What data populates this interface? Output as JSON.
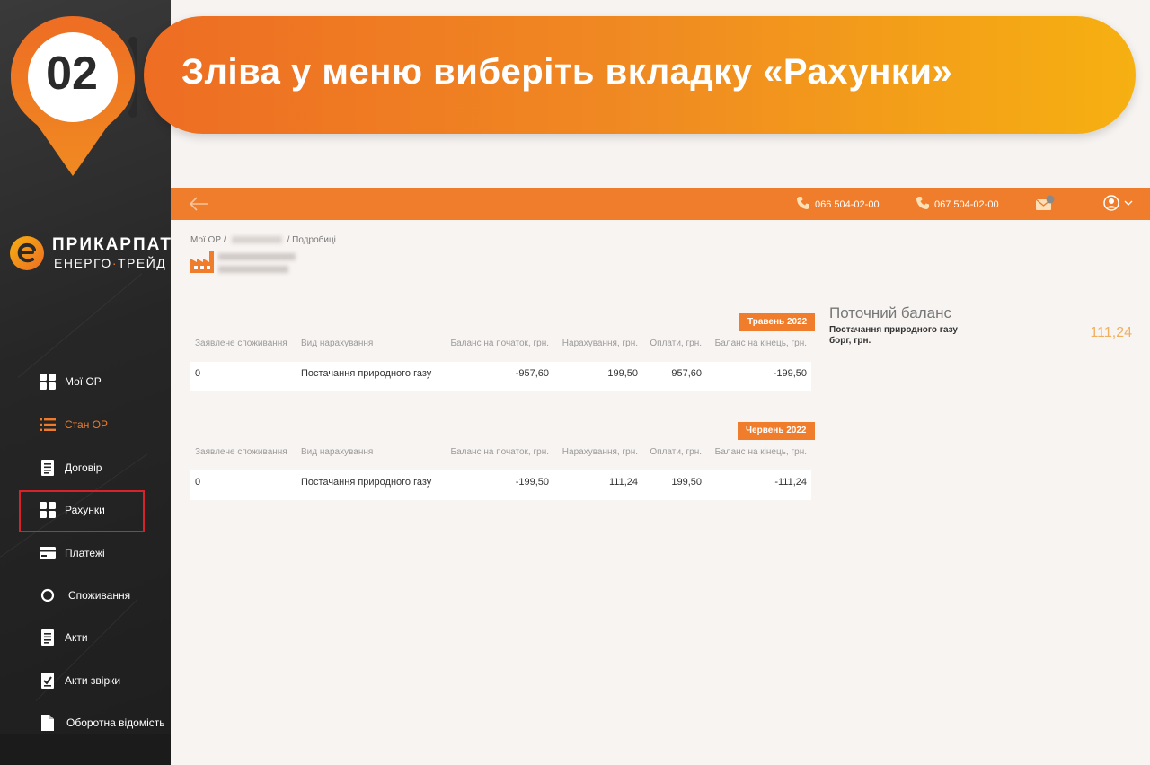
{
  "banner": {
    "step_number": "02",
    "text": "Зліва у меню виберіть вкладку «Рахунки»"
  },
  "logo": {
    "name": "ПРИКАРПАТ",
    "sub_left": "ЕНЕРГО",
    "sub_dot": "·",
    "sub_right": "ТРЕЙД"
  },
  "sidebar": {
    "items": [
      {
        "label": "Мої ОР",
        "icon": "grid-icon",
        "active": false
      },
      {
        "label": "Стан ОР",
        "icon": "list-icon",
        "active": true
      },
      {
        "label": "Договір",
        "icon": "document-icon",
        "active": false
      },
      {
        "label": "Рахунки",
        "icon": "grid-icon",
        "active": false,
        "highlighted": true
      },
      {
        "label": "Платежі",
        "icon": "card-icon",
        "active": false
      },
      {
        "label": "Споживання",
        "icon": "circle-icon",
        "active": false
      },
      {
        "label": "Акти",
        "icon": "document-icon",
        "active": false
      },
      {
        "label": "Акти звірки",
        "icon": "checklist-icon",
        "active": false
      },
      {
        "label": "Оборотна відомість",
        "icon": "file-icon",
        "active": false
      }
    ]
  },
  "header": {
    "phone1": "066 504-02-00",
    "phone2": "067 504-02-00"
  },
  "breadcrumb": {
    "root": "Мої ОР",
    "sep": "/",
    "current": "Подробиці"
  },
  "tables": [
    {
      "month": "Травень 2022",
      "headers": [
        "Заявлене споживання",
        "Вид нарахування",
        "Баланс на початок, грн.",
        "Нарахування, грн.",
        "Оплати, грн.",
        "Баланс на кінець, грн."
      ],
      "row": [
        "0",
        "Постачання природного газу",
        "-957,60",
        "199,50",
        "957,60",
        "-199,50"
      ]
    },
    {
      "month": "Червень 2022",
      "headers": [
        "Заявлене споживання",
        "Вид нарахування",
        "Баланс на початок, грн.",
        "Нарахування, грн.",
        "Оплати, грн.",
        "Баланс на кінець, грн."
      ],
      "row": [
        "0",
        "Постачання природного газу",
        "-199,50",
        "111,24",
        "199,50",
        "-111,24"
      ]
    }
  ],
  "balance": {
    "title": "Поточний баланс",
    "label": "Постачання природного газу борг, грн.",
    "value": "111,24"
  },
  "colors": {
    "accent": "#ef7d2c",
    "highlight": "#d7222c",
    "sidebar_bg": "#262626"
  }
}
